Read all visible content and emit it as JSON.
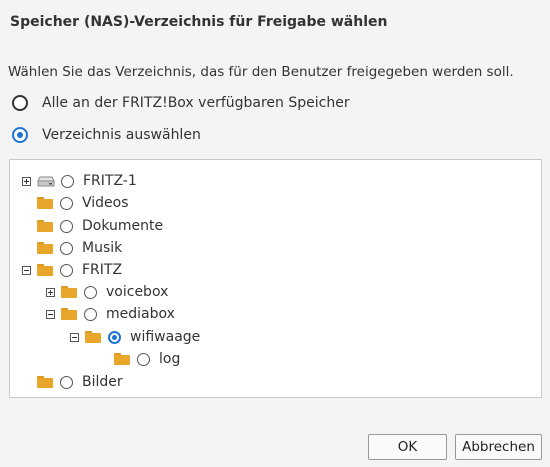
{
  "dialog": {
    "title": "Speicher (NAS)-Verzeichnis für Freigabe wählen",
    "description": "Wählen Sie das Verzeichnis, das für den Benutzer freigegeben werden soll."
  },
  "options": {
    "all_storage": "Alle an der FRITZ!Box verfügbaren Speicher",
    "choose_dir": "Verzeichnis auswählen"
  },
  "tree": {
    "nodes": [
      "FRITZ-1",
      "Videos",
      "Dokumente",
      "Musik",
      "FRITZ",
      "voicebox",
      "mediabox",
      "wifiwaage",
      "log",
      "Bilder"
    ],
    "selected": "wifiwaage"
  },
  "buttons": {
    "ok": "OK",
    "cancel": "Abbrechen"
  },
  "colors": {
    "accent": "#1d73d6",
    "folder": "#e8a72a"
  }
}
